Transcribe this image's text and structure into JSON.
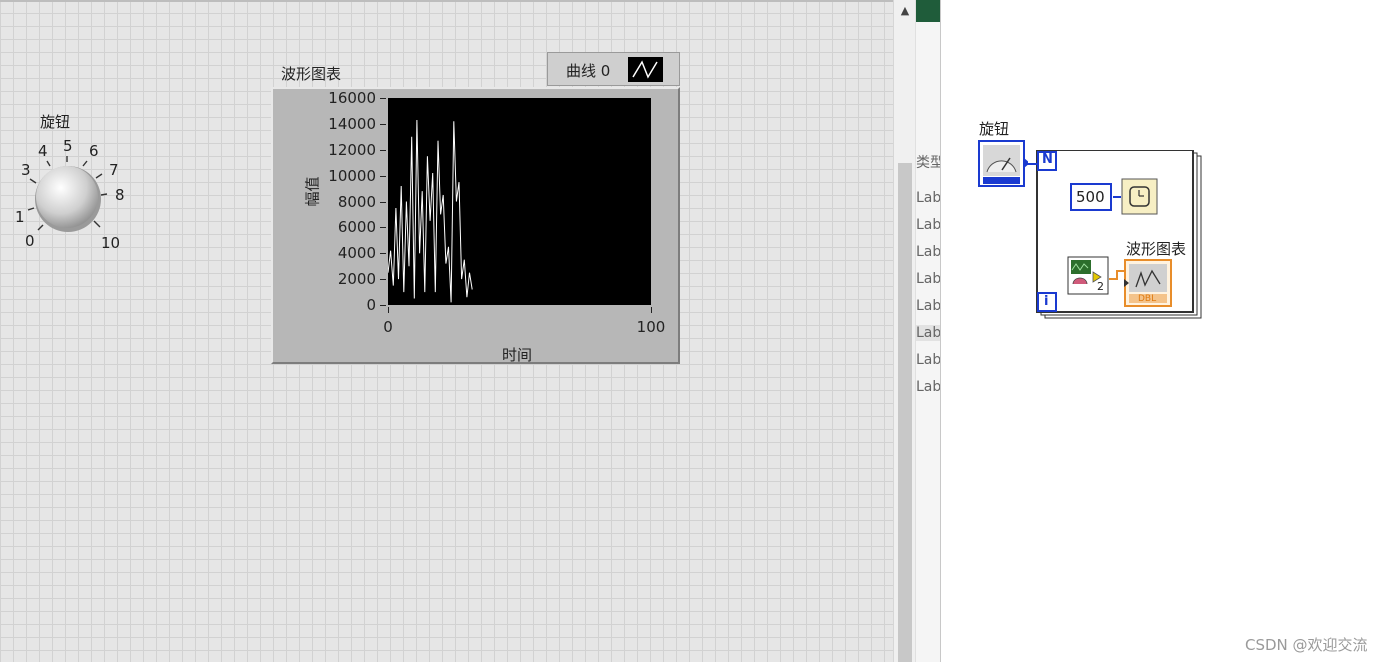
{
  "front_panel": {
    "knob": {
      "label": "旋钮",
      "scale": [
        "0",
        "1",
        "3",
        "4",
        "5",
        "6",
        "7",
        "8",
        "10"
      ]
    },
    "waveform_chart": {
      "label": "波形图表",
      "legend": {
        "plot_name": "曲线 0"
      },
      "y_ticks": [
        "16000",
        "14000",
        "12000",
        "10000",
        "8000",
        "6000",
        "4000",
        "2000",
        "0"
      ],
      "x_ticks": [
        "0",
        "100"
      ],
      "x_axis_label": "时间",
      "y_axis_label": "幅值"
    }
  },
  "middle_panel": {
    "text_partial": "类型",
    "items": [
      "Lab",
      "Lab",
      "Lab",
      "Lab",
      "Lab",
      "Lab",
      "Lab",
      "Lab"
    ]
  },
  "block_diagram": {
    "knob_terminal_label": "旋钮",
    "for_loop": {
      "count_terminal": "N",
      "iteration_terminal": "i"
    },
    "wait_constant": "500",
    "chart_terminal_label": "波形图表",
    "index_constant": "2",
    "dbl_label": "DBL"
  },
  "watermark": "CSDN @欢迎交流",
  "colors": {
    "plot_background": "#000000",
    "trace": "#ffffff",
    "terminal_blue": "#1a3ad0",
    "terminal_orange": "#e88d2a"
  },
  "chart_data": {
    "type": "line",
    "title": "波形图表",
    "xlabel": "时间",
    "ylabel": "幅值",
    "xlim": [
      0,
      100
    ],
    "ylim": [
      0,
      16000
    ],
    "series": [
      {
        "name": "曲线 0",
        "x": [
          0,
          1,
          2,
          3,
          4,
          5,
          6,
          7,
          8,
          9,
          10,
          11,
          12,
          13,
          14,
          15,
          16,
          17,
          18,
          19,
          20,
          21,
          22,
          23,
          24,
          25,
          26,
          27,
          28,
          29,
          30,
          31,
          32
        ],
        "values": [
          2500,
          4200,
          1500,
          7500,
          2000,
          9200,
          1000,
          8000,
          3000,
          13000,
          500,
          14300,
          4000,
          8800,
          1000,
          11500,
          6500,
          10200,
          1000,
          12700,
          7000,
          8500,
          3200,
          4500,
          200,
          14200,
          8000,
          9500,
          2000,
          3500,
          600,
          2500,
          1200
        ]
      }
    ]
  }
}
